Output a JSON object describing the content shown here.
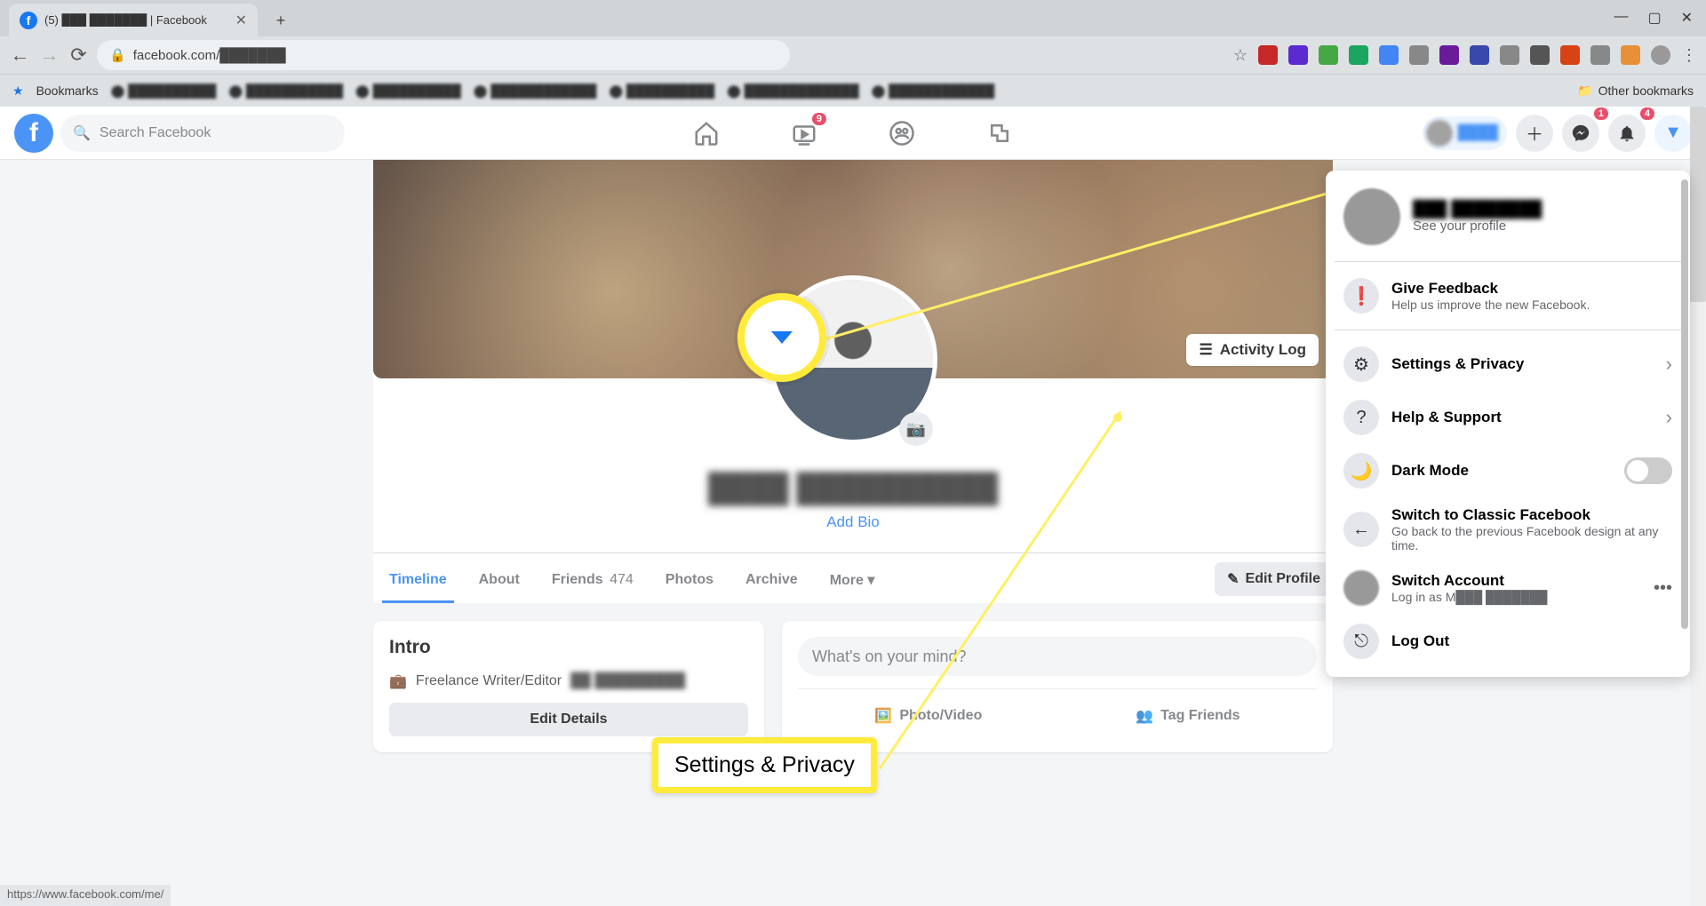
{
  "browser": {
    "tab_title": "(5) ███ ███████ | Facebook",
    "url": "facebook.com/███████",
    "bookmarks_label": "Bookmarks",
    "other_bookmarks": "Other bookmarks",
    "status_url": "https://www.facebook.com/me/"
  },
  "fb_header": {
    "search_placeholder": "Search Facebook",
    "watch_badge": "9",
    "messenger_badge": "1",
    "notifications_badge": "4"
  },
  "profile": {
    "name": "████ ██████████",
    "add_bio": "Add Bio",
    "activity_log": "Activity Log",
    "tabs": {
      "timeline": "Timeline",
      "about": "About",
      "friends": "Friends",
      "friends_count": "474",
      "photos": "Photos",
      "archive": "Archive",
      "more": "More"
    },
    "edit_profile": "Edit Profile",
    "intro": {
      "heading": "Intro",
      "job": "Freelance Writer/Editor",
      "job_extra": "██ █████████",
      "edit_details": "Edit Details"
    },
    "post": {
      "placeholder": "What's on your mind?",
      "photo_video": "Photo/Video",
      "tag_friends": "Tag Friends"
    }
  },
  "dropdown": {
    "profile_name": "███ ████████",
    "see_profile": "See your profile",
    "feedback": {
      "title": "Give Feedback",
      "sub": "Help us improve the new Facebook."
    },
    "settings": "Settings & Privacy",
    "help": "Help & Support",
    "dark_mode": "Dark Mode",
    "classic": {
      "title": "Switch to Classic Facebook",
      "sub": "Go back to the previous Facebook design at any time."
    },
    "switch_account": {
      "title": "Switch Account",
      "sub": "Log in as M███ ███████"
    },
    "logout": "Log Out"
  },
  "annotation": {
    "label": "Settings & Privacy"
  }
}
